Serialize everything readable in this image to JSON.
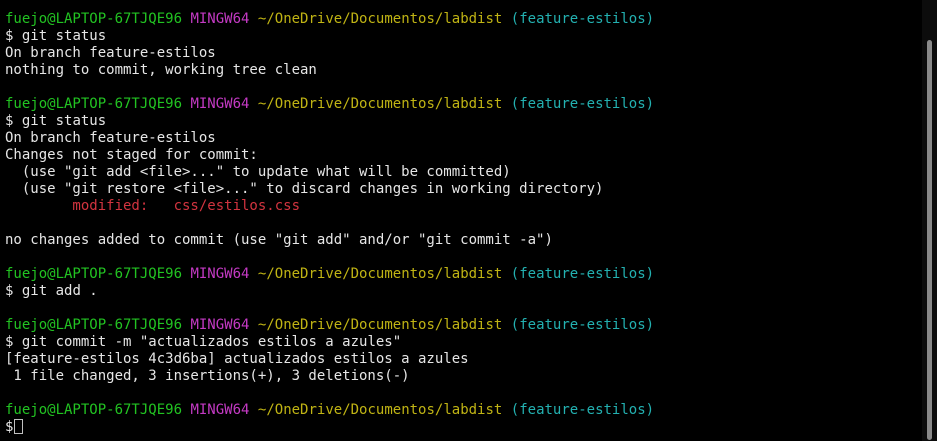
{
  "prompt": {
    "user_host": "fuejo@LAPTOP-67TJQE96",
    "shell": "MINGW64",
    "path": "~/OneDrive/Documentos/labdist",
    "branch": "(feature-estilos)",
    "symbol": "$"
  },
  "blocks": [
    {
      "command": "git status",
      "output": [
        "On branch feature-estilos",
        "nothing to commit, working tree clean"
      ]
    },
    {
      "command": "git status",
      "output": [
        "On branch feature-estilos",
        "Changes not staged for commit:",
        "  (use \"git add <file>...\" to update what will be committed)",
        "  (use \"git restore <file>...\" to discard changes in working directory)"
      ],
      "modified_label": "        modified:   css/estilos.css",
      "after_modified": "no changes added to commit (use \"git add\" and/or \"git commit -a\")"
    },
    {
      "command": "git add ."
    },
    {
      "command": "git commit -m \"actualizados estilos a azules\"",
      "output": [
        "[feature-estilos 4c3d6ba] actualizados estilos a azules",
        " 1 file changed, 3 insertions(+), 3 deletions(-)"
      ]
    }
  ],
  "colors": {
    "user_host": "#22c322",
    "shell": "#c43ac4",
    "path": "#c0b414",
    "branch": "#23b1b1",
    "modified": "#d2343f",
    "text": "#e6e6e6",
    "background": "#000000"
  }
}
